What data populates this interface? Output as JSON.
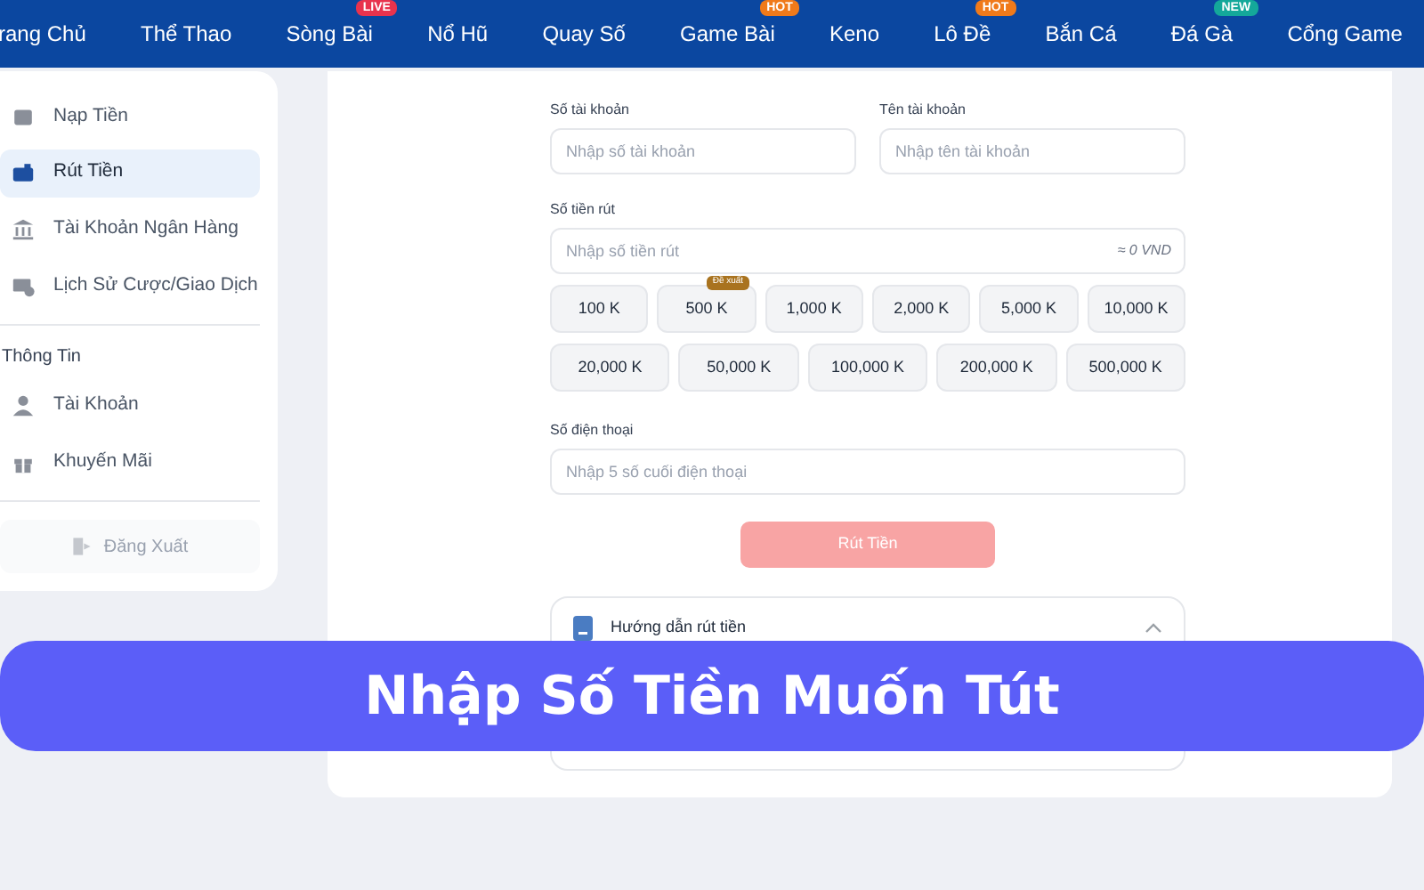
{
  "nav": [
    {
      "label": "rang Chủ"
    },
    {
      "label": "Thể Thao"
    },
    {
      "label": "Sòng Bài",
      "badge": "LIVE",
      "color": "#e8334d"
    },
    {
      "label": "Nổ Hũ"
    },
    {
      "label": "Quay Số"
    },
    {
      "label": "Game Bài",
      "badge": "HOT",
      "color": "#f07a1a"
    },
    {
      "label": "Keno"
    },
    {
      "label": "Lô Đề",
      "badge": "HOT",
      "color": "#f07a1a"
    },
    {
      "label": "Bắn Cá"
    },
    {
      "label": "Đá Gà",
      "badge": "NEW",
      "color": "#14a89a"
    },
    {
      "label": "Cổng Game"
    }
  ],
  "sidebar": {
    "sections": [
      {
        "items": [
          {
            "label": "Nạp Tiền",
            "selected": false
          },
          {
            "label": "Rút Tiền",
            "selected": true
          },
          {
            "label": "Tài Khoản Ngân Hàng",
            "selected": false
          },
          {
            "label": "Lịch Sử Cược/Giao Dịch",
            "selected": false
          }
        ]
      },
      {
        "heading": "Thông Tin",
        "items": [
          {
            "label": "Tài Khoản",
            "selected": false
          },
          {
            "label": "Khuyến Mãi",
            "selected": false
          }
        ]
      }
    ],
    "logout": "Đăng Xuất"
  },
  "form": {
    "account_number": {
      "label": "Số tài khoản",
      "placeholder": "Nhập số tài khoản"
    },
    "account_name": {
      "label": "Tên tài khoản",
      "placeholder": "Nhập tên tài khoản"
    },
    "amount": {
      "label": "Số tiền rút",
      "placeholder": "Nhập số tiền rút",
      "converted": "≈ 0 VND"
    },
    "amount_rows": [
      [
        {
          "label": "100 K"
        },
        {
          "label": "500 K",
          "badge": "Đề xuất"
        },
        {
          "label": "1,000 K"
        },
        {
          "label": "2,000 K"
        },
        {
          "label": "5,000 K"
        },
        {
          "label": "10,000 K"
        }
      ],
      [
        {
          "label": "20,000 K"
        },
        {
          "label": "50,000 K"
        },
        {
          "label": "100,000 K"
        },
        {
          "label": "200,000 K"
        },
        {
          "label": "500,000 K"
        }
      ]
    ],
    "phone": {
      "label": "Số điện thoại",
      "placeholder": "Nhập 5 số cuối điện thoại"
    },
    "submit": {
      "label": "Rút Tiền",
      "disabled": true
    },
    "guide": {
      "title": "Hướng dẫn rút tiền",
      "expanded": true
    }
  },
  "banner": {
    "title": "Nhập Số Tiền Muốn Tút"
  }
}
